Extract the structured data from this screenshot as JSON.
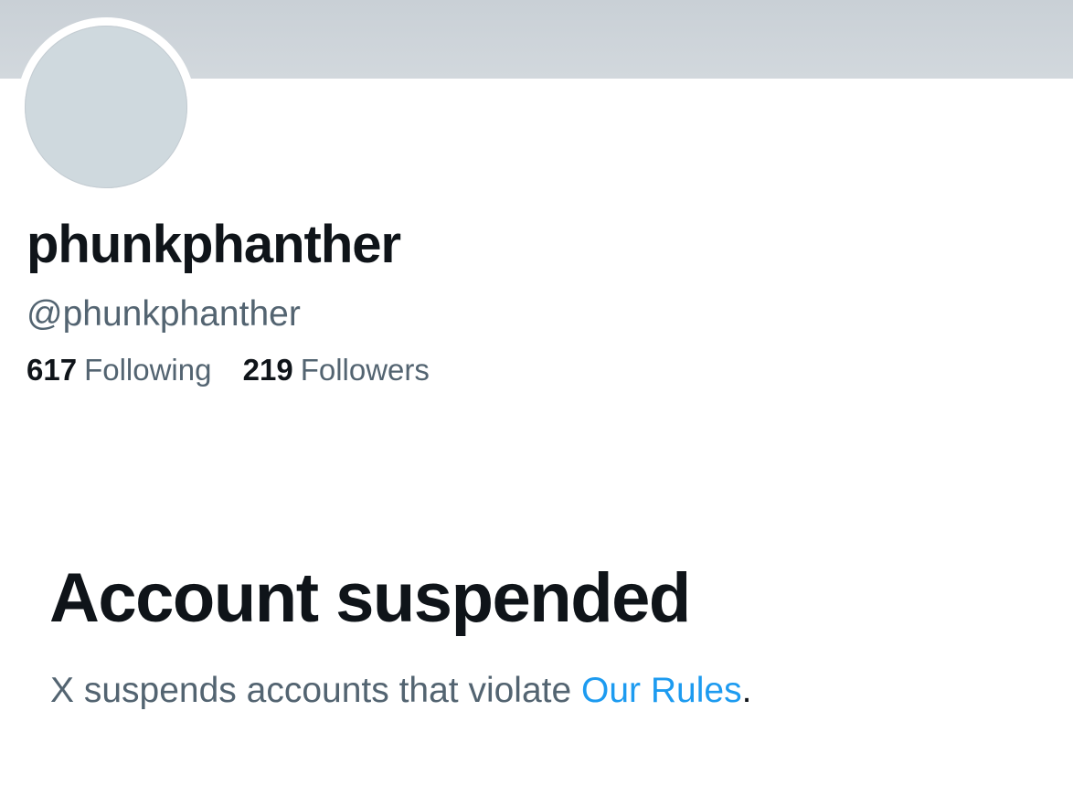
{
  "profile": {
    "display_name": "phunkphanther",
    "handle": "@phunkphanther",
    "following_count": "617",
    "following_label": "Following",
    "followers_count": "219",
    "followers_label": "Followers"
  },
  "suspension": {
    "title": "Account suspended",
    "message_prefix": "X suspends accounts that violate ",
    "rules_link": "Our Rules",
    "message_suffix": "."
  },
  "colors": {
    "banner": "#cfd9de",
    "avatar_placeholder": "#cfd9de",
    "primary_text": "#0f1419",
    "secondary_text": "#536471",
    "link": "#1d9bf0"
  }
}
